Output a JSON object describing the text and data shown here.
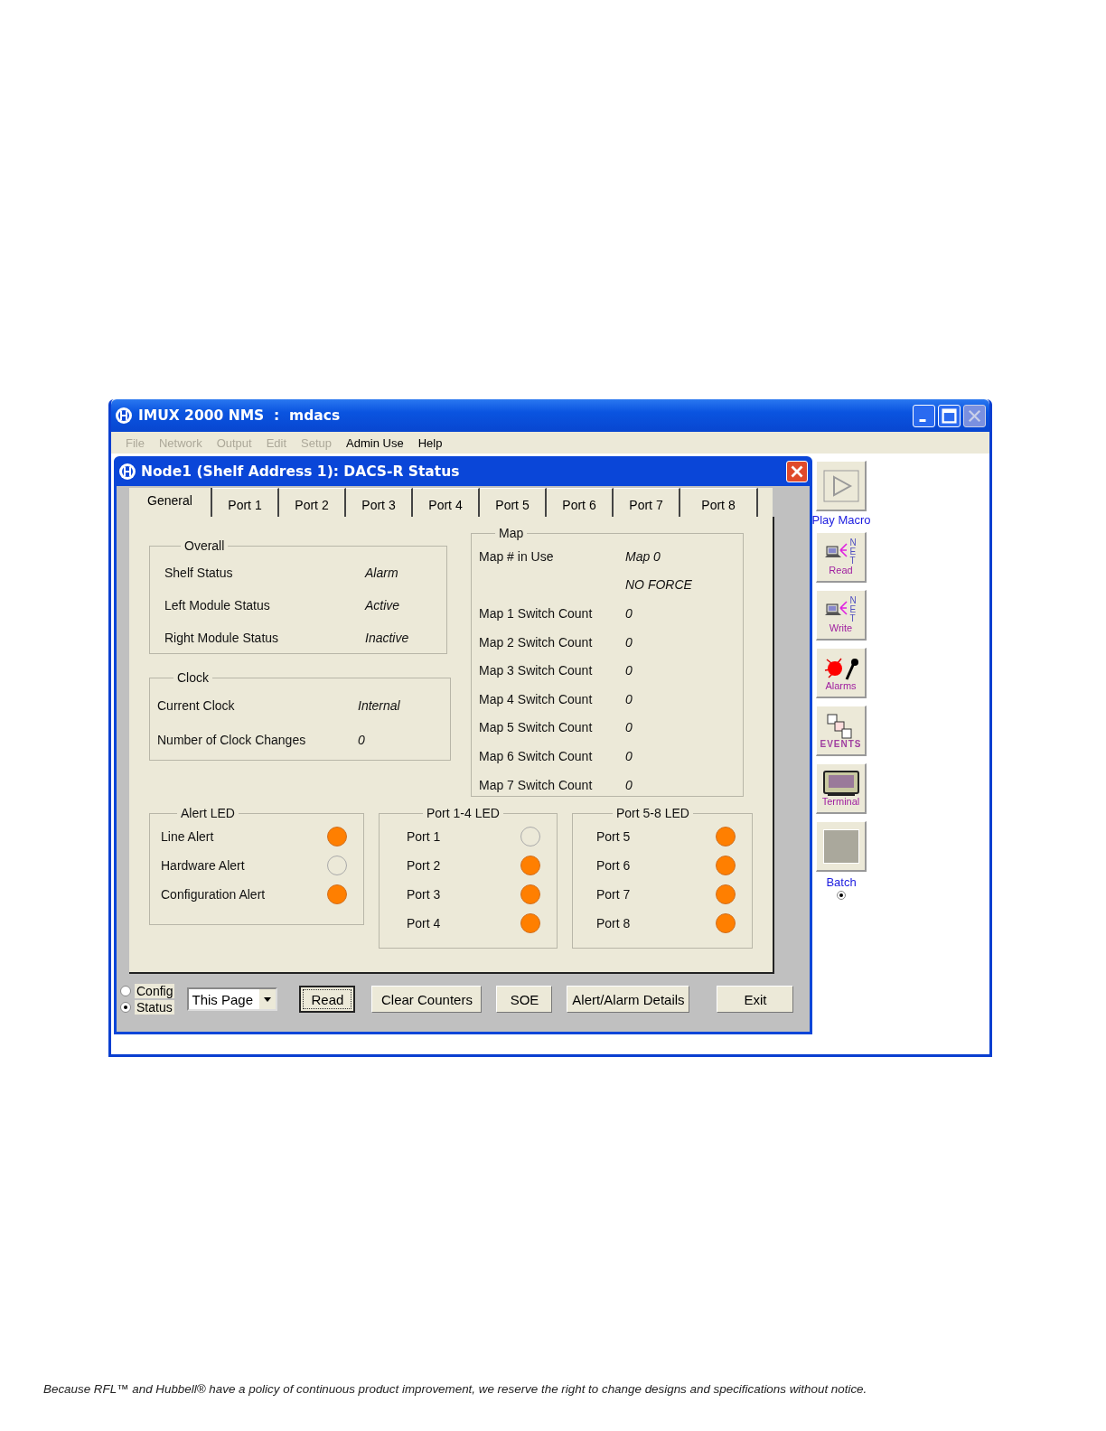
{
  "window": {
    "title": "IMUX 2000 NMS  :  mdacs"
  },
  "menu": [
    {
      "label": "File",
      "disabled": true
    },
    {
      "label": "Network",
      "disabled": true
    },
    {
      "label": "Output",
      "disabled": true
    },
    {
      "label": "Edit",
      "disabled": true
    },
    {
      "label": "Setup",
      "disabled": true
    },
    {
      "label": "Admin Use",
      "disabled": false
    },
    {
      "label": "Help",
      "disabled": false
    }
  ],
  "dialog": {
    "title": "Node1 (Shelf Address 1): DACS-R Status",
    "tabs": [
      {
        "label": "General",
        "selected": true
      },
      {
        "label": "Port 1",
        "selected": false
      },
      {
        "label": "Port 2",
        "selected": false
      },
      {
        "label": "Port 3",
        "selected": false
      },
      {
        "label": "Port 4",
        "selected": false
      },
      {
        "label": "Port 5",
        "selected": false
      },
      {
        "label": "Port 6",
        "selected": false
      },
      {
        "label": "Port 7",
        "selected": false
      },
      {
        "label": "Port 8",
        "selected": false
      }
    ],
    "overall": {
      "title": "Overall",
      "rows": [
        {
          "label": "Shelf Status",
          "value": "Alarm"
        },
        {
          "label": "Left Module Status",
          "value": "Active"
        },
        {
          "label": "Right Module Status",
          "value": "Inactive"
        }
      ]
    },
    "clock": {
      "title": "Clock",
      "rows": [
        {
          "label": "Current Clock",
          "value": "Internal"
        },
        {
          "label": "Number of Clock Changes",
          "value": "0"
        }
      ]
    },
    "map": {
      "title": "Map",
      "rows": [
        {
          "label": "Map # in Use",
          "value": "Map 0"
        },
        {
          "value": "NO FORCE"
        },
        {
          "label": "Map 1 Switch Count",
          "value": "0"
        },
        {
          "label": "Map 2 Switch Count",
          "value": "0"
        },
        {
          "label": "Map 3 Switch Count",
          "value": "0"
        },
        {
          "label": "Map 4 Switch Count",
          "value": "0"
        },
        {
          "label": "Map 5 Switch Count",
          "value": "0"
        },
        {
          "label": "Map 6 Switch Count",
          "value": "0"
        },
        {
          "label": "Map 7 Switch Count",
          "value": "0"
        }
      ]
    },
    "led_groups": [
      {
        "title": "Alert LED",
        "items": [
          {
            "label": "Line Alert",
            "on": true
          },
          {
            "label": "Hardware Alert",
            "on": false
          },
          {
            "label": "Configuration Alert",
            "on": true
          }
        ]
      },
      {
        "title": "Port 1-4 LED",
        "items": [
          {
            "label": "Port 1",
            "on": false
          },
          {
            "label": "Port 2",
            "on": true
          },
          {
            "label": "Port 3",
            "on": true
          },
          {
            "label": "Port 4",
            "on": true
          }
        ]
      },
      {
        "title": "Port 5-8 LED",
        "items": [
          {
            "label": "Port 5",
            "on": true
          },
          {
            "label": "Port 6",
            "on": true
          },
          {
            "label": "Port 7",
            "on": true
          },
          {
            "label": "Port 8",
            "on": true
          }
        ]
      }
    ],
    "mode_options": [
      {
        "label": "Config",
        "selected": false
      },
      {
        "label": "Status",
        "selected": true
      }
    ],
    "scope_select": {
      "value": "This Page"
    },
    "buttons": [
      {
        "label": "Read",
        "focused": true
      },
      {
        "label": "Clear Counters",
        "focused": false
      },
      {
        "label": "SOE",
        "focused": false
      },
      {
        "label": "Alert/Alarm Details",
        "focused": false
      },
      {
        "label": "Exit",
        "focused": false
      }
    ]
  },
  "toolbar": [
    {
      "kind": "play",
      "label": "Play Macro"
    },
    {
      "kind": "read",
      "label": "Read",
      "net_mark": "NET"
    },
    {
      "kind": "write",
      "label": "Write",
      "net_mark": "NET"
    },
    {
      "kind": "alarms",
      "label": "Alarms"
    },
    {
      "kind": "events",
      "label": "EVENTS"
    },
    {
      "kind": "terminal",
      "label": "Terminal"
    },
    {
      "kind": "batch",
      "label": "Batch",
      "selected": true
    }
  ],
  "footer": "Because RFL™ and Hubbell® have a policy of continuous product improvement, we reserve the right to change designs and specifications without notice."
}
